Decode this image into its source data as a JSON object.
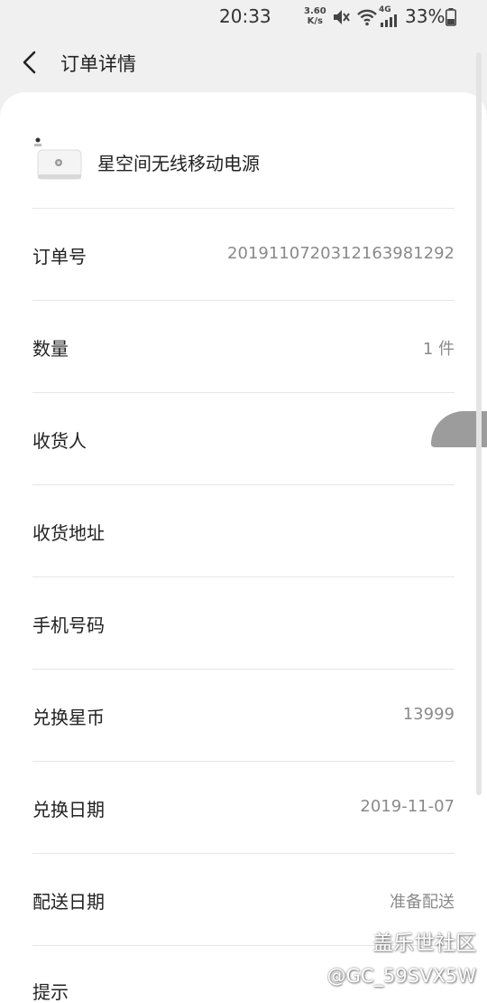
{
  "status_bar": {
    "time": "20:33",
    "net_speed_value": "3.60",
    "net_speed_unit": "K/s",
    "signal_type": "4G",
    "battery": "33%"
  },
  "header": {
    "title": "订单详情",
    "back_icon": "chevron-left-icon"
  },
  "product": {
    "name": "星空间无线移动电源"
  },
  "details": {
    "order_no": {
      "label": "订单号",
      "value": "20191107203121639812​92"
    },
    "quantity": {
      "label": "数量",
      "value": "1 件"
    },
    "receiver": {
      "label": "收货人",
      "value": ""
    },
    "address": {
      "label": "收货地址",
      "value": ""
    },
    "phone": {
      "label": "手机号码",
      "value": ""
    },
    "coins": {
      "label": "兑换星币",
      "value": "13999"
    },
    "redeem_date": {
      "label": "兑换日期",
      "value": "2019-11-07"
    },
    "delivery_date": {
      "label": "配送日期",
      "value": "准备配送"
    },
    "tip": {
      "label": "提示"
    }
  },
  "watermark": {
    "line1": "盖乐世社区",
    "line2": "@GC_59SVX5W"
  },
  "colors": {
    "background": "#f0f0f0",
    "card": "#ffffff",
    "value_text": "#8a8a8a",
    "divider": "#e6e6e6"
  }
}
